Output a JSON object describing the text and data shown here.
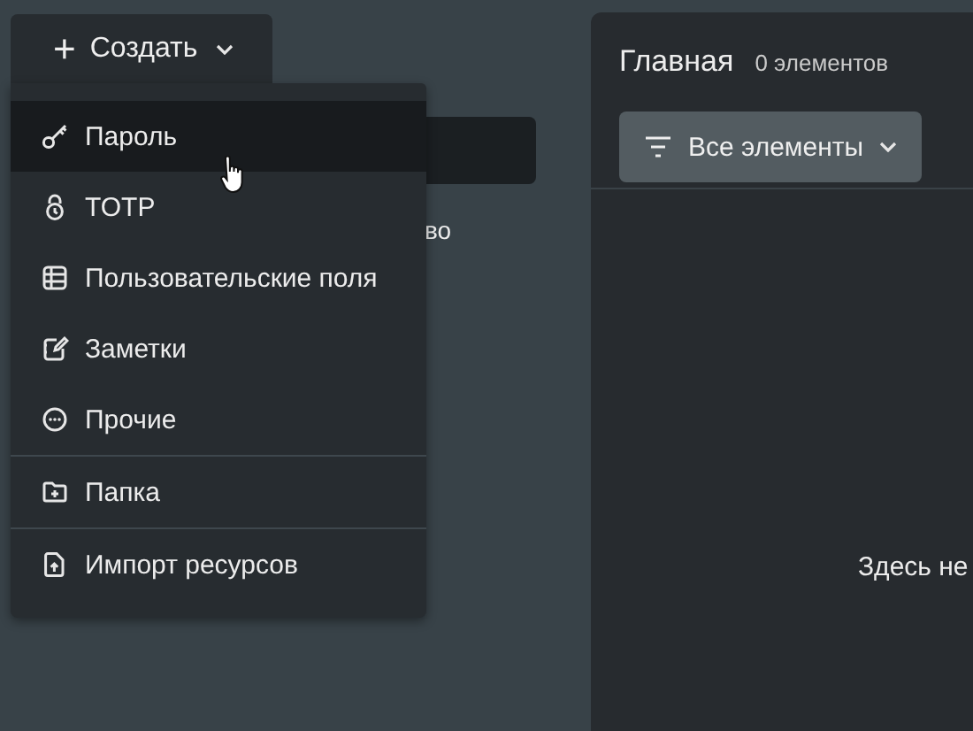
{
  "create_button": {
    "icon": "+",
    "label": "Создать",
    "expanded": true
  },
  "create_menu": {
    "sections": [
      {
        "items": [
          {
            "label": "Пароль",
            "highlighted": true
          },
          {
            "label": "TOTP",
            "highlighted": false
          },
          {
            "label": "Пользовательские поля",
            "highlighted": false
          },
          {
            "label": "Заметки",
            "highlighted": false
          },
          {
            "label": "Прочие",
            "highlighted": false
          }
        ]
      },
      {
        "items": [
          {
            "label": "Папка",
            "highlighted": false
          }
        ]
      },
      {
        "items": [
          {
            "label": "Импорт ресурсов",
            "highlighted": false
          }
        ]
      }
    ]
  },
  "sidebar": {
    "hidden_text_fragment": "во"
  },
  "main": {
    "title": "Главная",
    "count": "0 элементов",
    "filter": {
      "label": "Все элементы"
    },
    "empty_text": "Здесь не"
  }
}
